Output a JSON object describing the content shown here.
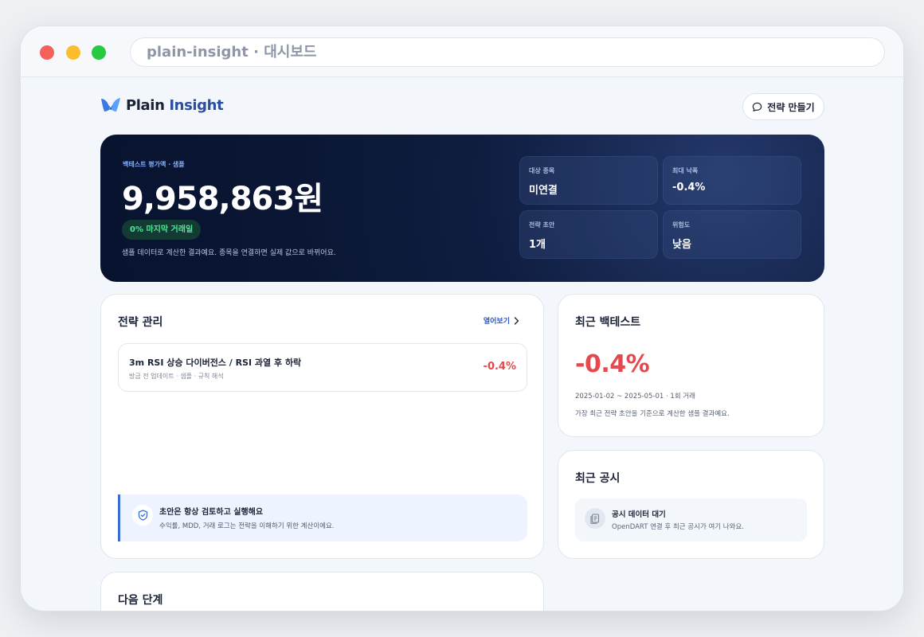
{
  "browser": {
    "url_text": "plain-insight · 대시보드"
  },
  "header": {
    "logo_word1": "Plain",
    "logo_word2": "Insight",
    "create_button_label": "전략 만들기"
  },
  "hero": {
    "eyebrow": "백테스트 평가액 · 샘플",
    "amount": "9,958,863원",
    "pill": "0% 마지막 거래일",
    "note": "샘플 데이터로 계산한 결과예요. 종목을 연결하면 실제 값으로 바뀌어요.",
    "stats": [
      {
        "label": "대상 종목",
        "value": "미연결"
      },
      {
        "label": "최대 낙폭",
        "value": "-0.4%"
      },
      {
        "label": "전략 초안",
        "value": "1개"
      },
      {
        "label": "위험도",
        "value": "낮음"
      }
    ]
  },
  "strategy_card": {
    "title": "전략 관리",
    "open_link": "열어보기",
    "item": {
      "name": "3m RSI 상승 다이버전스 / RSI 과열 후 하락",
      "sub": "방금 전 업데이트 · 샘플 · 규칙 해석",
      "return": "-0.4%"
    },
    "tip": {
      "title": "초안은 항상 검토하고 실행해요",
      "sub": "수익률, MDD, 거래 로그는 전략을 이해하기 위한 계산이에요."
    }
  },
  "backtest_card": {
    "title": "최근 백테스트",
    "value": "-0.4%",
    "range": "2025-01-02 ~ 2025-05-01 · 1회 거래",
    "note": "가장 최근 전략 초안을 기준으로 계산한 샘플 결과예요."
  },
  "disclosure_card": {
    "title": "최근 공시",
    "item_title": "공시 데이터 대기",
    "item_sub": "OpenDART 연결 후 최근 공시가 여기 나와요."
  },
  "next_card": {
    "title": "다음 단계"
  },
  "colors": {
    "accent_blue": "#2a55c9",
    "negative_red": "#e5484d",
    "positive_green": "#53e39a",
    "hero_navy": "#0a1633"
  },
  "icons": {
    "logo": "wing-logo-icon",
    "create": "chat-bubble-icon",
    "open": "chevron-right-icon",
    "tip": "shield-check-icon",
    "disclosure": "document-icon"
  }
}
